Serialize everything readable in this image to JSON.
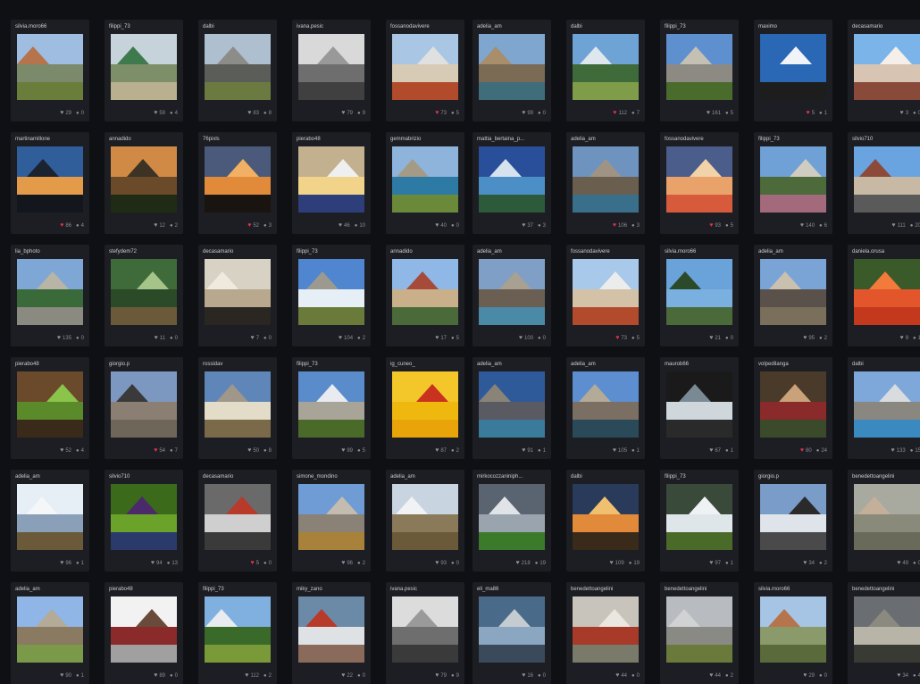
{
  "palette": {
    "background": "#0f1013",
    "card": "#1c1e23",
    "text": "#c9ccd1",
    "muted": "#8a8e96",
    "like_active": "#e2324a"
  },
  "icons": {
    "like": "heart-icon",
    "comment": "comment-icon"
  },
  "rows": [
    [
      {
        "user": "silvia.moro66",
        "likes": "29",
        "comments": "0",
        "liked": false,
        "thumb": {
          "sky": "#9fbde0",
          "mid": "#7a8a6a",
          "ground": "#6b7d3a",
          "accent": "#b5744c"
        }
      },
      {
        "user": "filippi_73",
        "likes": "59",
        "comments": "4",
        "liked": false,
        "thumb": {
          "sky": "#c6d3db",
          "mid": "#7c8f68",
          "ground": "#b9b08f",
          "accent": "#3e7a4d"
        }
      },
      {
        "user": "dalbi",
        "likes": "83",
        "comments": "8",
        "liked": false,
        "thumb": {
          "sky": "#aebfcf",
          "mid": "#5b5d58",
          "ground": "#6a7a40",
          "accent": "#8c8c88"
        }
      },
      {
        "user": "ivana.pesic",
        "likes": "79",
        "comments": "9",
        "liked": false,
        "thumb": {
          "sky": "#d9d9d9",
          "mid": "#6e6e6e",
          "ground": "#404040",
          "accent": "#999999"
        }
      },
      {
        "user": "fossanodavivere",
        "likes": "73",
        "comments": "5",
        "liked": true,
        "thumb": {
          "sky": "#a9c7e4",
          "mid": "#d7cbb5",
          "ground": "#b24a2c",
          "accent": "#e0e0e0"
        }
      },
      {
        "user": "adelia_am",
        "likes": "99",
        "comments": "0",
        "liked": false,
        "thumb": {
          "sky": "#7fa6cf",
          "mid": "#7b6a54",
          "ground": "#3f6d7a",
          "accent": "#a88e6b"
        }
      },
      {
        "user": "dalbi",
        "likes": "112",
        "comments": "7",
        "liked": true,
        "thumb": {
          "sky": "#6ea3d6",
          "mid": "#3f6b3a",
          "ground": "#7f9c4a",
          "accent": "#dfe7ee"
        }
      },
      {
        "user": "filippi_73",
        "likes": "161",
        "comments": "5",
        "liked": false,
        "thumb": {
          "sky": "#5e90cf",
          "mid": "#8c8a83",
          "ground": "#496b2c",
          "accent": "#c4c0b4"
        }
      },
      {
        "user": "maximo",
        "likes": "5",
        "comments": "1",
        "liked": true,
        "thumb": {
          "sky": "#2a67b4",
          "mid": "#2a67b4",
          "ground": "#1d1d1d",
          "accent": "#f0f4f9"
        }
      },
      {
        "user": "decasamario",
        "likes": "3",
        "comments": "0",
        "liked": false,
        "thumb": {
          "sky": "#7ab4e8",
          "mid": "#d8c4b2",
          "ground": "#8a4a3a",
          "accent": "#f4efe8"
        }
      }
    ],
    [
      {
        "user": "martinamillone",
        "likes": "86",
        "comments": "4",
        "liked": true,
        "thumb": {
          "sky": "#2f5e9a",
          "mid": "#e39b4a",
          "ground": "#13161d",
          "accent": "#1b2230"
        }
      },
      {
        "user": "annadido",
        "likes": "12",
        "comments": "2",
        "liked": false,
        "thumb": {
          "sky": "#d08a45",
          "mid": "#6b4a2a",
          "ground": "#1f2b14",
          "accent": "#3c3325"
        }
      },
      {
        "user": "76pixls",
        "likes": "52",
        "comments": "3",
        "liked": true,
        "thumb": {
          "sky": "#4b5a7a",
          "mid": "#e08a3a",
          "ground": "#1a1410",
          "accent": "#f2b064"
        }
      },
      {
        "user": "pierabo48",
        "likes": "46",
        "comments": "10",
        "liked": false,
        "thumb": {
          "sky": "#c2b08e",
          "mid": "#f1d38a",
          "ground": "#2e3e7a",
          "accent": "#efefef"
        }
      },
      {
        "user": "gemmabrizio",
        "likes": "40",
        "comments": "0",
        "liked": false,
        "thumb": {
          "sky": "#8fb4dc",
          "mid": "#2d7aa5",
          "ground": "#6a8a3a",
          "accent": "#a49b86"
        }
      },
      {
        "user": "mattia_bertaina_p...",
        "likes": "37",
        "comments": "3",
        "liked": false,
        "thumb": {
          "sky": "#2a4f9a",
          "mid": "#4c8fc6",
          "ground": "#2c5a3a",
          "accent": "#d6e3ee"
        }
      },
      {
        "user": "adelia_am",
        "likes": "106",
        "comments": "3",
        "liked": true,
        "thumb": {
          "sky": "#6f93bf",
          "mid": "#6a5f4f",
          "ground": "#3a6f8c",
          "accent": "#9f9384"
        }
      },
      {
        "user": "fossanodavivere",
        "likes": "93",
        "comments": "5",
        "liked": true,
        "thumb": {
          "sky": "#4b5d8a",
          "mid": "#e9a36a",
          "ground": "#d85a3c",
          "accent": "#f2d2a8"
        }
      },
      {
        "user": "filippi_73",
        "likes": "140",
        "comments": "6",
        "liked": false,
        "thumb": {
          "sky": "#6fa1d6",
          "mid": "#4c6a3a",
          "ground": "#a36a7c",
          "accent": "#d0ccc2"
        }
      },
      {
        "user": "silvio710",
        "likes": "111",
        "comments": "20",
        "liked": false,
        "thumb": {
          "sky": "#6aa4e0",
          "mid": "#c7b9a3",
          "ground": "#5a5a5a",
          "accent": "#8c4a3a"
        }
      }
    ],
    [
      {
        "user": "lia_bphoto",
        "likes": "135",
        "comments": "0",
        "liked": false,
        "thumb": {
          "sky": "#7fa7d6",
          "mid": "#3a6a3a",
          "ground": "#8a8a80",
          "accent": "#b8b4a6"
        }
      },
      {
        "user": "stefydem72",
        "likes": "11",
        "comments": "0",
        "liked": false,
        "thumb": {
          "sky": "#3f6a3a",
          "mid": "#2a4a28",
          "ground": "#6a5a3a",
          "accent": "#a5c48a"
        }
      },
      {
        "user": "decasamario",
        "likes": "7",
        "comments": "0",
        "liked": false,
        "thumb": {
          "sky": "#d8d2c4",
          "mid": "#b7a88e",
          "ground": "#2a2622",
          "accent": "#efe9de"
        }
      },
      {
        "user": "filippi_73",
        "likes": "104",
        "comments": "2",
        "liked": false,
        "thumb": {
          "sky": "#4f86cf",
          "mid": "#e6eef6",
          "ground": "#6a7a3a",
          "accent": "#9c9a8e"
        }
      },
      {
        "user": "annadido",
        "likes": "17",
        "comments": "5",
        "liked": false,
        "thumb": {
          "sky": "#8fb8e6",
          "mid": "#c9b08a",
          "ground": "#4a6a3a",
          "accent": "#a64a3a"
        }
      },
      {
        "user": "adelia_am",
        "likes": "100",
        "comments": "0",
        "liked": false,
        "thumb": {
          "sky": "#7f9fc6",
          "mid": "#6a5f52",
          "ground": "#4a8aa6",
          "accent": "#a8a090"
        }
      },
      {
        "user": "fossanodavivere",
        "likes": "73",
        "comments": "5",
        "liked": true,
        "thumb": {
          "sky": "#a9c9ea",
          "mid": "#d3c2a8",
          "ground": "#b24a2c",
          "accent": "#ececec"
        }
      },
      {
        "user": "silvia.moro66",
        "likes": "21",
        "comments": "0",
        "liked": false,
        "thumb": {
          "sky": "#6aa2da",
          "mid": "#7ab0e0",
          "ground": "#4a6a3a",
          "accent": "#2a4a2a"
        }
      },
      {
        "user": "adelia_am",
        "likes": "95",
        "comments": "2",
        "liked": false,
        "thumb": {
          "sky": "#7aa4d6",
          "mid": "#5a524a",
          "ground": "#7a6f5a",
          "accent": "#c9c0b0"
        }
      },
      {
        "user": "daniela.orusa",
        "likes": "9",
        "comments": "1",
        "liked": false,
        "thumb": {
          "sky": "#3a5a2a",
          "mid": "#e3552a",
          "ground": "#c4381e",
          "accent": "#f27a3a"
        }
      }
    ],
    [
      {
        "user": "pierabo48",
        "likes": "52",
        "comments": "4",
        "liked": false,
        "thumb": {
          "sky": "#6a4a2a",
          "mid": "#5a8a2a",
          "ground": "#3a2a1a",
          "accent": "#8ac44a"
        }
      },
      {
        "user": "giorgio.p",
        "likes": "54",
        "comments": "7",
        "liked": true,
        "thumb": {
          "sky": "#7c98c0",
          "mid": "#8a7f72",
          "ground": "#6f665a",
          "accent": "#3a3a3a"
        }
      },
      {
        "user": "rossidav",
        "likes": "50",
        "comments": "8",
        "liked": false,
        "thumb": {
          "sky": "#5f86b8",
          "mid": "#e3dcc8",
          "ground": "#7a6a4a",
          "accent": "#a0968a"
        }
      },
      {
        "user": "filippi_73",
        "likes": "99",
        "comments": "5",
        "liked": false,
        "thumb": {
          "sky": "#5a8ccc",
          "mid": "#a8a498",
          "ground": "#4a6a2a",
          "accent": "#e8ecf0"
        }
      },
      {
        "user": "ig_cuneo_",
        "likes": "87",
        "comments": "2",
        "liked": false,
        "thumb": {
          "sky": "#f3c62a",
          "mid": "#efb80f",
          "ground": "#e8a408",
          "accent": "#c8321e"
        }
      },
      {
        "user": "adelia_am",
        "likes": "91",
        "comments": "1",
        "liked": false,
        "thumb": {
          "sky": "#2f5a9a",
          "mid": "#5a5a62",
          "ground": "#3a7a9a",
          "accent": "#8a8478"
        }
      },
      {
        "user": "adelia_am",
        "likes": "105",
        "comments": "1",
        "liked": false,
        "thumb": {
          "sky": "#5c8ed0",
          "mid": "#7a6f62",
          "ground": "#2a4a5a",
          "accent": "#b4aa98"
        }
      },
      {
        "user": "maurob66",
        "likes": "67",
        "comments": "1",
        "liked": false,
        "thumb": {
          "sky": "#1a1a1a",
          "mid": "#cfd7dc",
          "ground": "#2a2a2a",
          "accent": "#7a8a94"
        }
      },
      {
        "user": "volpedilanga",
        "likes": "80",
        "comments": "24",
        "liked": true,
        "thumb": {
          "sky": "#4a3a2a",
          "mid": "#8a2a2a",
          "ground": "#3a4a2a",
          "accent": "#c9a27a"
        }
      },
      {
        "user": "dalbi",
        "likes": "133",
        "comments": "15",
        "liked": false,
        "thumb": {
          "sky": "#7fa8da",
          "mid": "#8a8680",
          "ground": "#3a8ac0",
          "accent": "#d8dcde"
        }
      }
    ],
    [
      {
        "user": "adelia_am",
        "likes": "96",
        "comments": "1",
        "liked": false,
        "thumb": {
          "sky": "#e6eef6",
          "mid": "#8aa0b8",
          "ground": "#6a5a3a",
          "accent": "#f4f6f8"
        }
      },
      {
        "user": "silvio710",
        "likes": "94",
        "comments": "13",
        "liked": false,
        "thumb": {
          "sky": "#3a6a1a",
          "mid": "#6aa22a",
          "ground": "#2a3a6a",
          "accent": "#4a2a6a"
        }
      },
      {
        "user": "decasamario",
        "likes": "5",
        "comments": "0",
        "liked": true,
        "thumb": {
          "sky": "#6a6a6a",
          "mid": "#cfcfcf",
          "ground": "#3a3a3a",
          "accent": "#b83a2a"
        }
      },
      {
        "user": "simone_mondino",
        "likes": "96",
        "comments": "2",
        "liked": false,
        "thumb": {
          "sky": "#6f9cd4",
          "mid": "#8a8276",
          "ground": "#a8823a",
          "accent": "#c4bcae"
        }
      },
      {
        "user": "adelia_am",
        "likes": "93",
        "comments": "0",
        "liked": false,
        "thumb": {
          "sky": "#c8d4e0",
          "mid": "#8a7a5a",
          "ground": "#6a5a3a",
          "accent": "#f0f2f4"
        }
      },
      {
        "user": "mirkocozzaniniph...",
        "likes": "218",
        "comments": "19",
        "liked": false,
        "thumb": {
          "sky": "#5a6470",
          "mid": "#9aa4ae",
          "ground": "#3a7a2a",
          "accent": "#e0e4e8"
        }
      },
      {
        "user": "dalbi",
        "likes": "109",
        "comments": "19",
        "liked": false,
        "thumb": {
          "sky": "#2a3a5a",
          "mid": "#e08a3a",
          "ground": "#3a2a1a",
          "accent": "#f0c070"
        }
      },
      {
        "user": "filippi_73",
        "likes": "97",
        "comments": "1",
        "liked": false,
        "thumb": {
          "sky": "#3a4a3a",
          "mid": "#dfe6ea",
          "ground": "#4a6a2a",
          "accent": "#eef2f4"
        }
      },
      {
        "user": "giorgio.p",
        "likes": "34",
        "comments": "2",
        "liked": false,
        "thumb": {
          "sky": "#7a9cc8",
          "mid": "#dfe4ea",
          "ground": "#4a4a4a",
          "accent": "#2a2a2a"
        }
      },
      {
        "user": "benedettoangelini",
        "likes": "49",
        "comments": "0",
        "liked": false,
        "thumb": {
          "sky": "#a8aaa0",
          "mid": "#8a8a7a",
          "ground": "#6a6a5a",
          "accent": "#c4b09a"
        }
      }
    ],
    [
      {
        "user": "adelia_am",
        "likes": "90",
        "comments": "1",
        "liked": false,
        "thumb": {
          "sky": "#8fb6e6",
          "mid": "#8a7a62",
          "ground": "#7a9a4a",
          "accent": "#b4aa98"
        }
      },
      {
        "user": "pierabo48",
        "likes": "89",
        "comments": "0",
        "liked": false,
        "thumb": {
          "sky": "#f2f2f2",
          "mid": "#8a2a2a",
          "ground": "#a0a0a0",
          "accent": "#6a4a3a"
        }
      },
      {
        "user": "filippi_73",
        "likes": "112",
        "comments": "2",
        "liked": false,
        "thumb": {
          "sky": "#7fb0e0",
          "mid": "#3a6a2a",
          "ground": "#7a9a3a",
          "accent": "#e8ecf0"
        }
      },
      {
        "user": "miky_zano",
        "likes": "22",
        "comments": "0",
        "liked": false,
        "thumb": {
          "sky": "#6a8aa8",
          "mid": "#dfe2e4",
          "ground": "#8a6a5a",
          "accent": "#b83a2a"
        }
      },
      {
        "user": "ivana.pesic",
        "likes": "79",
        "comments": "9",
        "liked": false,
        "thumb": {
          "sky": "#dcdcdc",
          "mid": "#6e6e6e",
          "ground": "#3a3a3a",
          "accent": "#9a9a9a"
        }
      },
      {
        "user": "eli_ma86",
        "likes": "16",
        "comments": "0",
        "liked": false,
        "thumb": {
          "sky": "#4a6a8a",
          "mid": "#8aa6c0",
          "ground": "#3a4a5a",
          "accent": "#c4ccd2"
        }
      },
      {
        "user": "benedettoangelini",
        "likes": "44",
        "comments": "0",
        "liked": false,
        "thumb": {
          "sky": "#c8c4bc",
          "mid": "#a83a2a",
          "ground": "#7a7a6a",
          "accent": "#eae6e0"
        }
      },
      {
        "user": "benedettoangelini",
        "likes": "44",
        "comments": "2",
        "liked": false,
        "thumb": {
          "sky": "#b8bcc0",
          "mid": "#8a8a84",
          "ground": "#6a7a3a",
          "accent": "#d0d2d4"
        }
      },
      {
        "user": "silvia.moro66",
        "likes": "29",
        "comments": "0",
        "liked": false,
        "thumb": {
          "sky": "#a6c4e4",
          "mid": "#8a9a6a",
          "ground": "#5a6a3a",
          "accent": "#b5744c"
        }
      },
      {
        "user": "benedettoangelini",
        "likes": "34",
        "comments": "4",
        "liked": false,
        "thumb": {
          "sky": "#6a6e72",
          "mid": "#b8b4a8",
          "ground": "#3a3a34",
          "accent": "#8a8a80"
        }
      }
    ]
  ]
}
